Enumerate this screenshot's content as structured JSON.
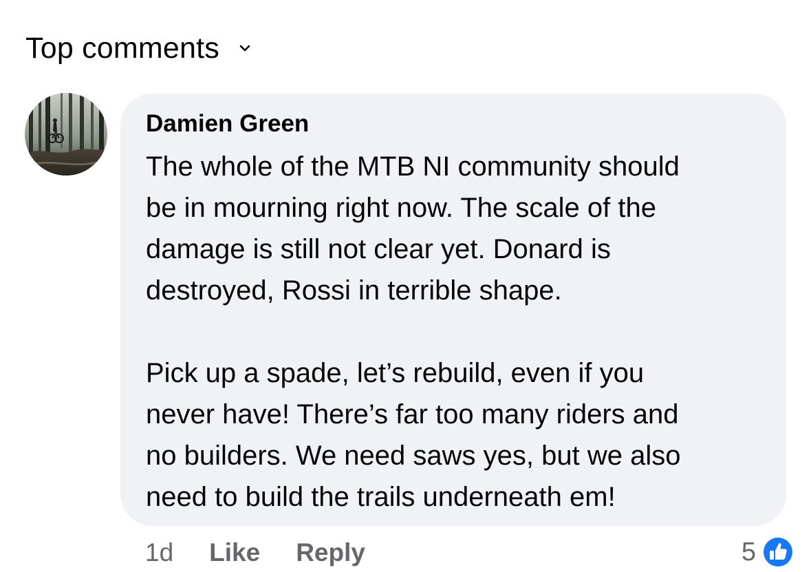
{
  "header": {
    "sort_label": "Top comments",
    "sort_icon": "chevron-down-icon"
  },
  "comment": {
    "author": "Damien Green",
    "avatar_icon": "profile-photo-forest",
    "paragraphs": [
      "The whole of the MTB NI community should\nbe in mourning right now. The scale of the\ndamage is still not clear yet. Donard is\ndestroyed, Rossi in terrible shape.",
      "Pick up a spade, let’s rebuild, even if you\nnever have! There’s far too many riders and\nno builders. We need saws yes, but we also\nneed to build the trails underneath em!"
    ],
    "timestamp": "1d",
    "like_label": "Like",
    "reply_label": "Reply",
    "reaction_count": "5",
    "reaction_icon": "like-thumbs-up-icon"
  },
  "colors": {
    "bubble_bg": "#f0f2f5",
    "meta_text": "#65676b",
    "like_blue": "#1877f2"
  }
}
